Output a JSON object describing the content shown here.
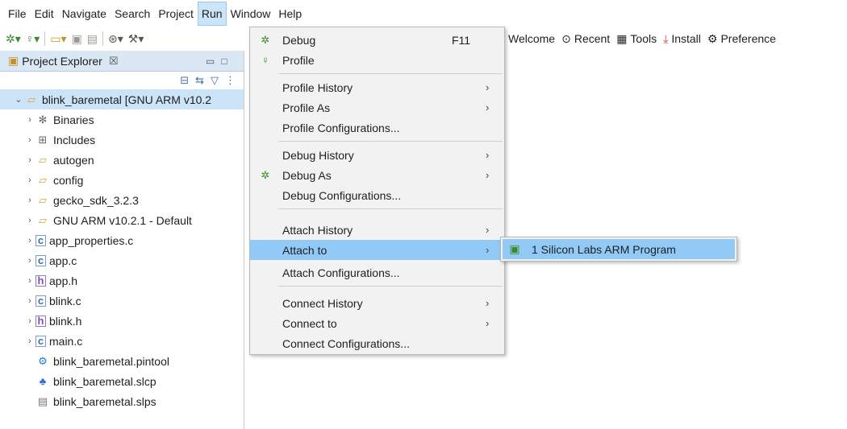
{
  "menubar": {
    "items": [
      "File",
      "Edit",
      "Navigate",
      "Search",
      "Project",
      "Run",
      "Window",
      "Help"
    ],
    "active": "Run"
  },
  "toolbar": {
    "welcome": "Welcome",
    "recent": "Recent",
    "tools": "Tools",
    "install": "Install",
    "preferences": "Preference"
  },
  "explorer": {
    "title": "Project Explorer",
    "close_glyph": "☒",
    "root": "blink_baremetal [GNU ARM v10.2",
    "items": [
      {
        "label": "Binaries",
        "icon": "binaries-icon"
      },
      {
        "label": "Includes",
        "icon": "includes-icon"
      },
      {
        "label": "autogen",
        "icon": "folder-icon"
      },
      {
        "label": "config",
        "icon": "folder-icon"
      },
      {
        "label": "gecko_sdk_3.2.3",
        "icon": "folder-icon"
      },
      {
        "label": "GNU ARM v10.2.1 - Default",
        "icon": "folder-icon"
      },
      {
        "label": "app_properties.c",
        "icon": "c-file-icon"
      },
      {
        "label": "app.c",
        "icon": "c-file-icon"
      },
      {
        "label": "app.h",
        "icon": "h-file-icon"
      },
      {
        "label": "blink.c",
        "icon": "c-file-icon"
      },
      {
        "label": "blink.h",
        "icon": "h-file-icon"
      },
      {
        "label": "main.c",
        "icon": "c-file-icon"
      },
      {
        "label": "blink_baremetal.pintool",
        "icon": "pintool-icon"
      },
      {
        "label": "blink_baremetal.slcp",
        "icon": "slcp-icon"
      },
      {
        "label": "blink_baremetal.slps",
        "icon": "slps-icon"
      }
    ]
  },
  "run_menu": {
    "items": [
      {
        "label": "Debug",
        "shortcut": "F11",
        "icon": "debug-icon"
      },
      {
        "label": "Profile",
        "icon": "profile-icon"
      },
      {
        "label": "Profile History",
        "submenu": true
      },
      {
        "label": "Profile As",
        "submenu": true
      },
      {
        "label": "Profile Configurations..."
      },
      {
        "label": "Debug History",
        "submenu": true
      },
      {
        "label": "Debug As",
        "submenu": true,
        "icon": "debug-icon"
      },
      {
        "label": "Debug Configurations..."
      },
      {
        "label": "Attach History",
        "submenu": true
      },
      {
        "label": "Attach to",
        "submenu": true,
        "highlighted": true
      },
      {
        "label": "Attach Configurations..."
      },
      {
        "label": "Connect History",
        "submenu": true
      },
      {
        "label": "Connect to",
        "submenu": true
      },
      {
        "label": "Connect Configurations..."
      }
    ]
  },
  "attach_submenu": {
    "item": "1 Silicon Labs ARM Program"
  }
}
